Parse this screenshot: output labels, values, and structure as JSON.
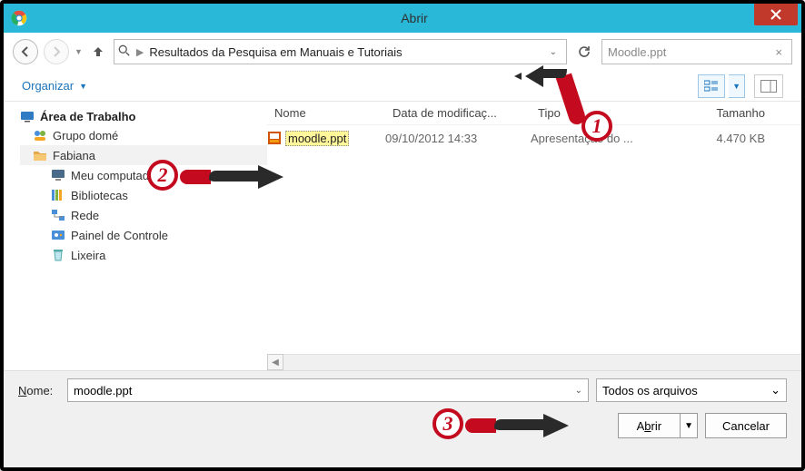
{
  "window": {
    "title": "Abrir"
  },
  "nav": {
    "breadcrumb": "Resultados da Pesquisa em Manuais e Tutoriais",
    "search_value": "Moodle.ppt"
  },
  "toolbar": {
    "organize_label": "Organizar"
  },
  "sidebar": {
    "root": "Área de Trabalho",
    "items": [
      {
        "label": "Grupo domé",
        "icon": "homegroup"
      },
      {
        "label": "Fabiana",
        "icon": "user-folder",
        "selected": true
      },
      {
        "label": "Meu computador",
        "icon": "computer",
        "indent": true
      },
      {
        "label": "Bibliotecas",
        "icon": "libraries",
        "indent": true
      },
      {
        "label": "Rede",
        "icon": "network",
        "indent": true
      },
      {
        "label": "Painel de Controle",
        "icon": "control-panel",
        "indent": true
      },
      {
        "label": "Lixeira",
        "icon": "recycle-bin",
        "indent": true
      }
    ]
  },
  "columns": {
    "name": "Nome",
    "date": "Data de modificaç...",
    "type": "Tipo",
    "size": "Tamanho"
  },
  "files": [
    {
      "name": "moodle.ppt",
      "date": "09/10/2012 14:33",
      "type": "Apresentação do ...",
      "size": "4.470 KB"
    }
  ],
  "footer": {
    "name_label": "Nome:",
    "name_value": "moodle.ppt",
    "filter_value": "Todos os arquivos",
    "open_label": "Abrir",
    "cancel_label": "Cancelar"
  },
  "annotations": {
    "b1": "1",
    "b2": "2",
    "b3": "3"
  }
}
